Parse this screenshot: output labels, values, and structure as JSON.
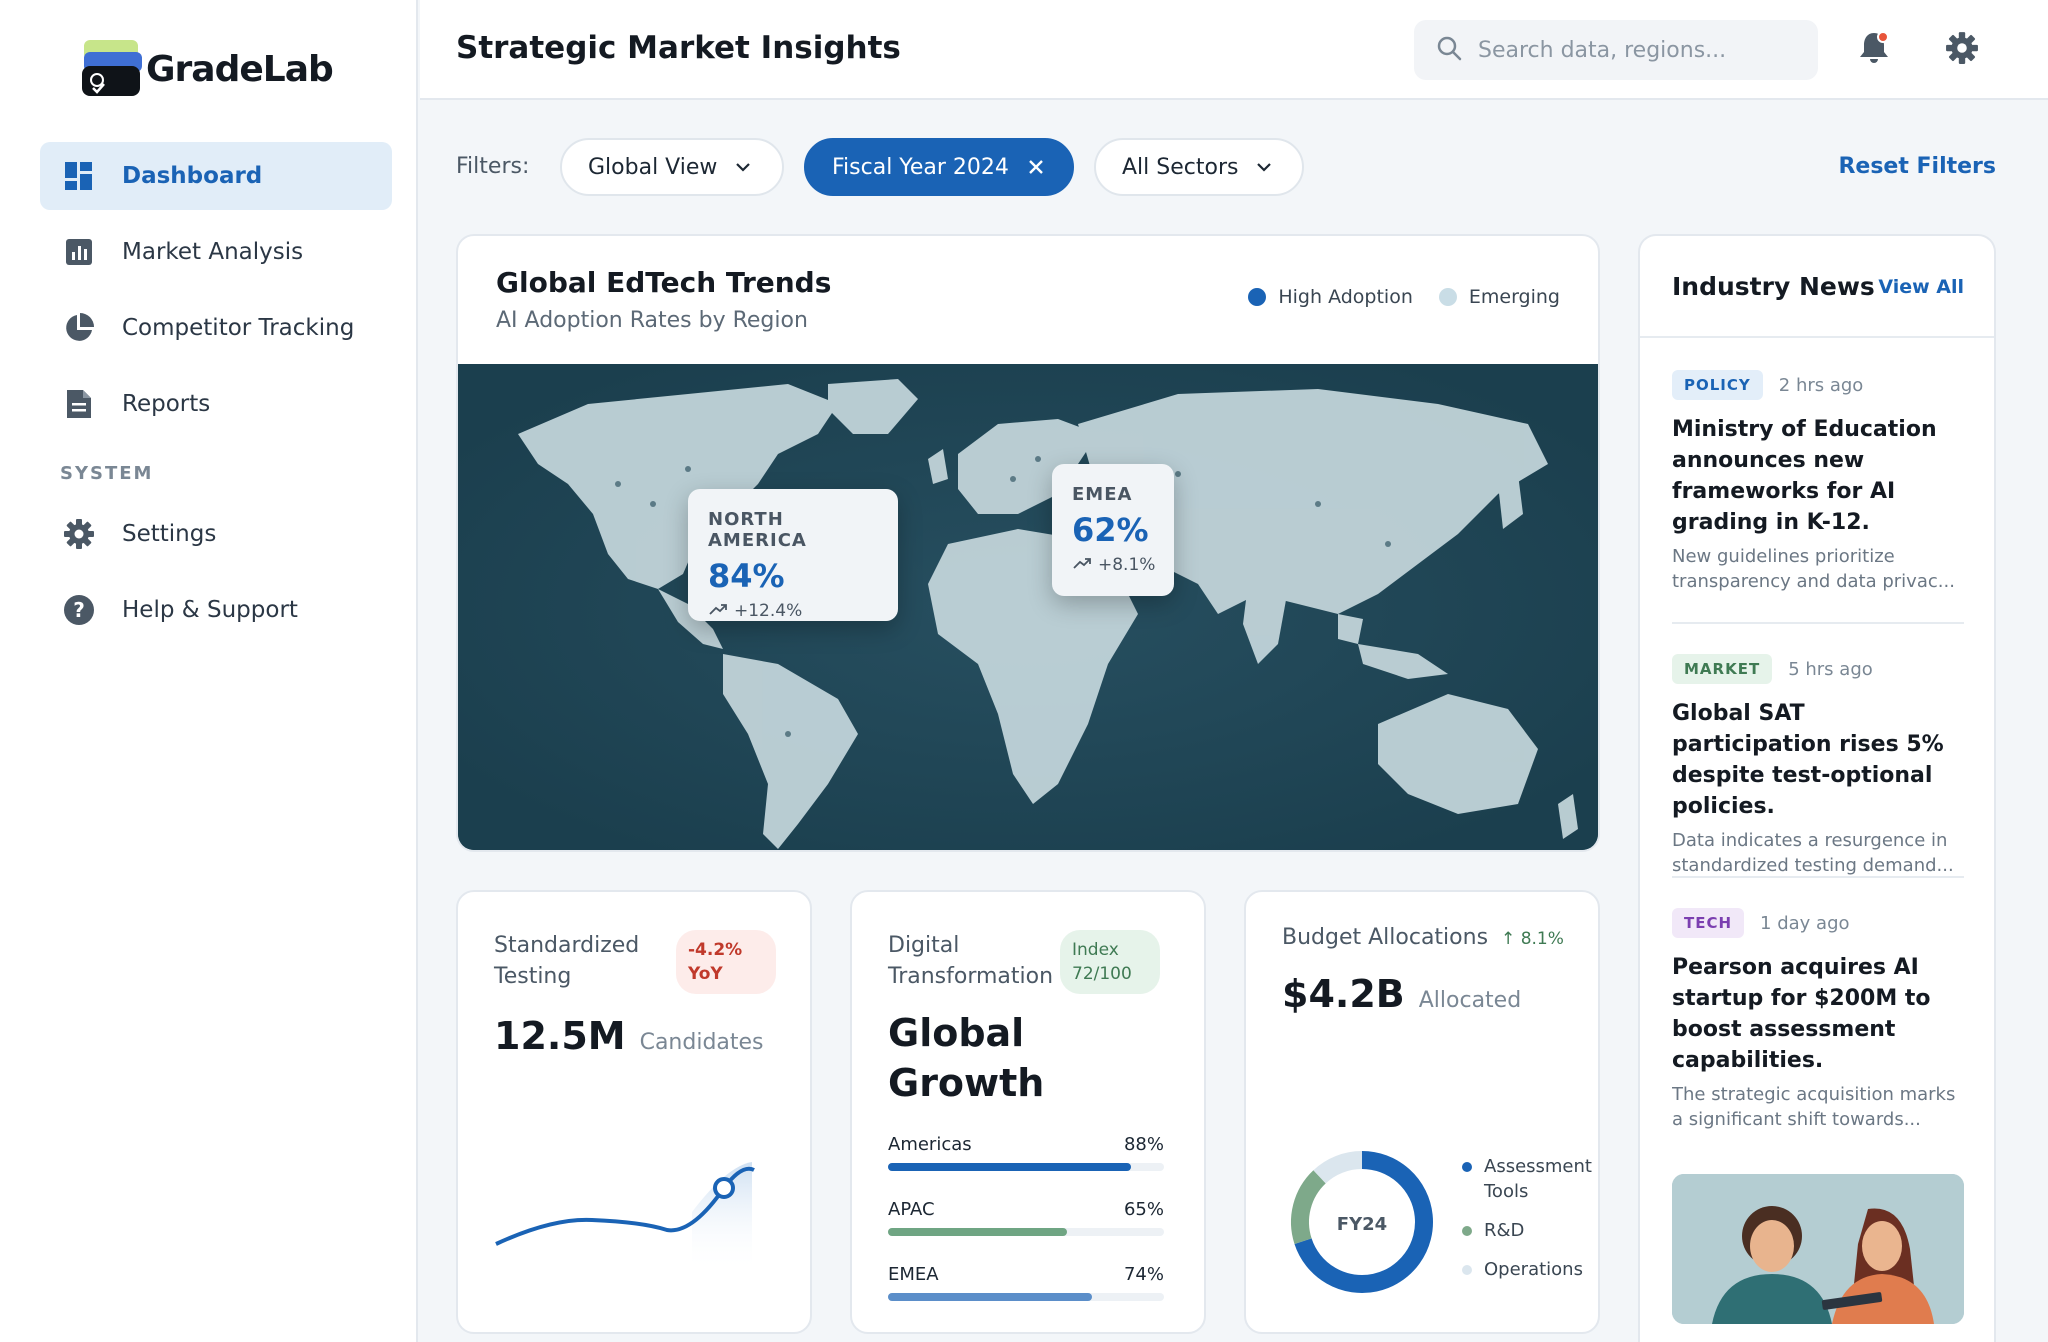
{
  "brand": {
    "name": "GradeLab"
  },
  "sidebar": {
    "items": [
      {
        "label": "Dashboard",
        "icon": "dashboard-icon",
        "active": true
      },
      {
        "label": "Market Analysis",
        "icon": "bar-chart-icon",
        "active": false
      },
      {
        "label": "Competitor Tracking",
        "icon": "pie-chart-icon",
        "active": false
      },
      {
        "label": "Reports",
        "icon": "document-icon",
        "active": false
      }
    ],
    "section_label": "SYSTEM",
    "system_items": [
      {
        "label": "Settings",
        "icon": "gear-icon"
      },
      {
        "label": "Help & Support",
        "icon": "help-icon"
      }
    ]
  },
  "header": {
    "title": "Strategic Market Insights",
    "search_placeholder": "Search data, regions...",
    "notification_icon": "bell-icon",
    "settings_icon": "gear-icon"
  },
  "filters": {
    "label": "Filters:",
    "chips": [
      {
        "label": "Global View",
        "active": false,
        "icon": "chevron-down-icon"
      },
      {
        "label": "Fiscal Year 2024",
        "active": true,
        "icon": "close-icon"
      },
      {
        "label": "All Sectors",
        "active": false,
        "icon": "chevron-down-icon"
      }
    ],
    "reset_label": "Reset Filters"
  },
  "map_card": {
    "title": "Global EdTech Trends",
    "subtitle": "AI Adoption Rates by Region",
    "legend": [
      {
        "label": "High Adoption",
        "color": "#1a63b5"
      },
      {
        "label": "Emerging",
        "color": "#c9dde6"
      }
    ],
    "callouts": [
      {
        "region": "NORTH AMERICA",
        "value": "84%",
        "delta": "+12.4%"
      },
      {
        "region": "EMEA",
        "value": "62%",
        "delta": "+8.1%"
      }
    ]
  },
  "news": {
    "title": "Industry News",
    "view_all": "View All",
    "items": [
      {
        "tag": "POLICY",
        "tag_color": "#1a63b5",
        "tag_bg": "#e3eef9",
        "time": "2 hrs ago",
        "title": "Ministry of Education announces new frameworks for AI grading in K-12.",
        "desc": "New guidelines prioritize transparency and data privac..."
      },
      {
        "tag": "MARKET",
        "tag_color": "#3f7a53",
        "tag_bg": "#e6f3ea",
        "time": "5 hrs ago",
        "title": "Global SAT participation rises 5% despite test-optional policies.",
        "desc": "Data indicates a resurgence in standardized testing demand..."
      },
      {
        "tag": "TECH",
        "tag_color": "#7b3fb0",
        "tag_bg": "#f1e8f8",
        "time": "1 day ago",
        "title": "Pearson acquires AI startup for $200M to boost assessment capabilities.",
        "desc": "The strategic acquisition marks a significant shift towards..."
      }
    ]
  },
  "kpi_testing": {
    "title": "Standardized Testing",
    "badge": "-4.2% YoY",
    "value": "12.5M",
    "unit": "Candidates"
  },
  "kpi_digital": {
    "title": "Digital Transformation",
    "badge": "Index 72/100",
    "headline": "Global Growth",
    "bars": [
      {
        "label": "Americas",
        "value": 88,
        "display": "88%",
        "color": "#1a63b5"
      },
      {
        "label": "APAC",
        "value": 65,
        "display": "65%",
        "color": "#6fa583"
      },
      {
        "label": "EMEA",
        "value": 74,
        "display": "74%",
        "color": "#5b8ec9"
      }
    ]
  },
  "kpi_budget": {
    "title": "Budget Allocations",
    "change": "8.1%",
    "value": "$4.2B",
    "unit": "Allocated",
    "center_label": "FY24",
    "segments": [
      {
        "label": "Assessment Tools",
        "value": 70,
        "color": "#1a63b5"
      },
      {
        "label": "R&D",
        "value": 18,
        "color": "#7ea98a"
      },
      {
        "label": "Operations",
        "value": 12,
        "color": "#dbe6ee"
      }
    ]
  }
}
